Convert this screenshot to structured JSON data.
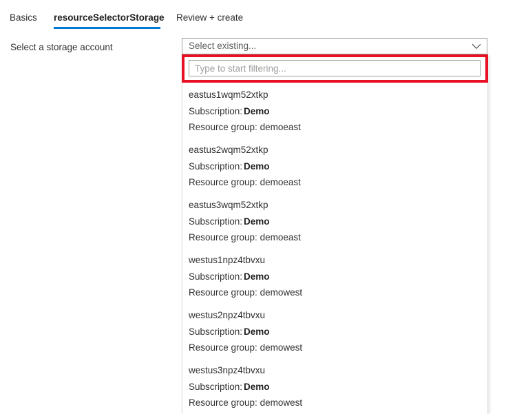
{
  "colors": {
    "accent": "#0078d4",
    "annotation": "#e81123",
    "text": "#323130",
    "placeholder": "#a19f9d",
    "border": "#a19f9d",
    "panel_border": "#e1dfdd"
  },
  "tabs": [
    {
      "label": "Basics",
      "selected": false
    },
    {
      "label": "resourceSelectorStorage",
      "selected": true
    },
    {
      "label": "Review + create",
      "selected": false
    }
  ],
  "form": {
    "field_label": "Select a storage account"
  },
  "combobox": {
    "value": "Select existing...",
    "chevron_icon": "chevron-down-icon",
    "expanded": true
  },
  "filter": {
    "value": "",
    "placeholder": "Type to start filtering..."
  },
  "labels": {
    "subscription": "Subscription:",
    "resource_group": "Resource group:"
  },
  "options": [
    {
      "name": "eastus1wqm52xtkp",
      "subscription": "Demo",
      "resource_group": "demoeast"
    },
    {
      "name": "eastus2wqm52xtkp",
      "subscription": "Demo",
      "resource_group": "demoeast"
    },
    {
      "name": "eastus3wqm52xtkp",
      "subscription": "Demo",
      "resource_group": "demoeast"
    },
    {
      "name": "westus1npz4tbvxu",
      "subscription": "Demo",
      "resource_group": "demowest"
    },
    {
      "name": "westus2npz4tbvxu",
      "subscription": "Demo",
      "resource_group": "demowest"
    },
    {
      "name": "westus3npz4tbvxu",
      "subscription": "Demo",
      "resource_group": "demowest"
    }
  ]
}
